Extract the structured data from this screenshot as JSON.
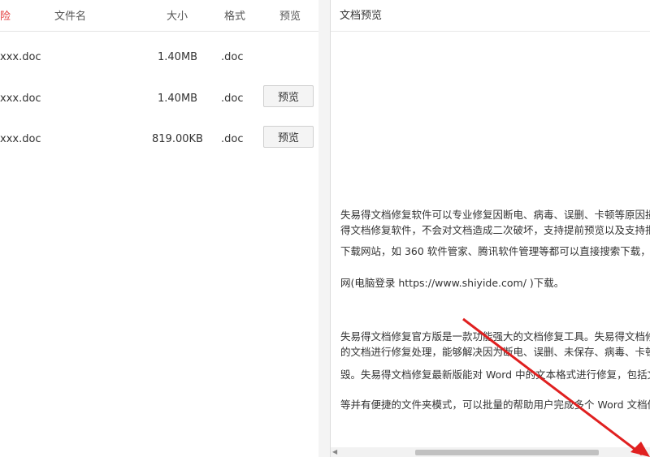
{
  "file_table": {
    "headers": {
      "delete": "险",
      "name": "文件名",
      "size": "大小",
      "format": "格式",
      "preview": "预览"
    },
    "rows": [
      {
        "name": "xxx.doc",
        "size": "1.40MB",
        "format": ".doc",
        "preview_label": ""
      },
      {
        "name": "xxx.doc",
        "size": "1.40MB",
        "format": ".doc",
        "preview_label": "预览"
      },
      {
        "name": "xxx.doc",
        "size": "819.00KB",
        "format": ".doc",
        "preview_label": "预览"
      }
    ]
  },
  "preview_panel": {
    "title": "文档预览",
    "lines": [
      "失易得文档修复软件可以专业修复因断电、病毒、误删、卡顿等原因损",
      "得文档修复软件，不会对文档造成二次破坏，支持提前预览以及支持批",
      "下载网站，如 360 软件管家、腾讯软件管理等都可以直接搜索下载，",
      "网(电脑登录 https://www.shiyide.com/ )下载。",
      "失易得文档修复官方版是一款功能强大的文档修复工具。失易得文档修",
      "的文档进行修复处理，能够解决因为断电、误删、未保存、病毒、卡顿",
      "毁。失易得文档修复最新版能对 Word 中的文本格式进行修复，包括文",
      "等并有便捷的文件夹模式，可以批量的帮助用户完成多个 Word 文档修"
    ]
  },
  "colors": {
    "delete_header": "#e23b3b",
    "annotation_arrow": "#e02020"
  }
}
